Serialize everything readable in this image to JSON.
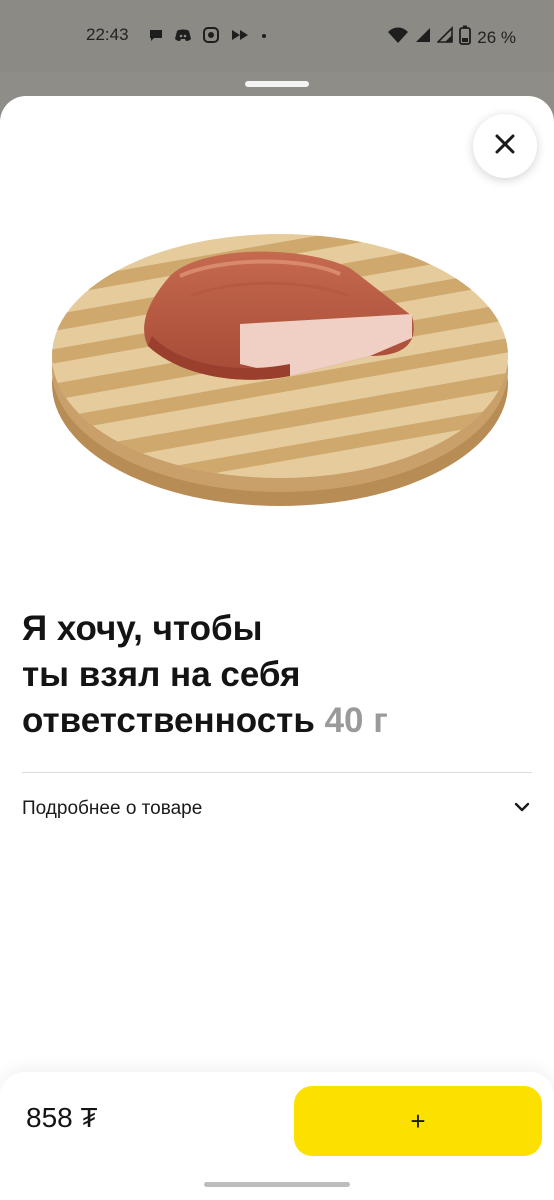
{
  "status_bar": {
    "time": "22:43",
    "battery": "26 %",
    "left_icons": [
      "chat-bubble-icon",
      "discord-icon",
      "app-icon",
      "forward-icon",
      "dot-icon"
    ],
    "right_icons": [
      "wifi-icon",
      "signal-icon",
      "signal-icon",
      "battery-icon"
    ]
  },
  "product": {
    "title_line1": "Я хочу, чтобы",
    "title_line2": "ты взял на себя",
    "title_line3": "ответственность",
    "weight": "40 г",
    "details_label": "Подробнее о товаре",
    "image_alt": "smoked-brisket-on-cutting-board"
  },
  "purchase": {
    "price": "858 ₮",
    "add_label": "+"
  },
  "colors": {
    "accent_yellow": "#fce000",
    "overlay_gray": "#8c8a84",
    "weight_gray": "#9a9a9a"
  }
}
